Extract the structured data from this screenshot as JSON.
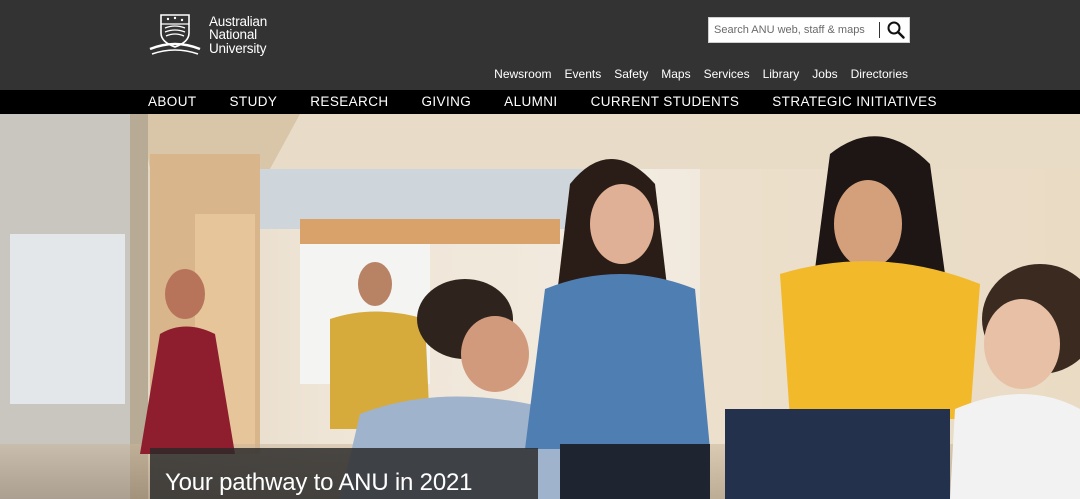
{
  "logo": {
    "lines": [
      "Australian",
      "National",
      "University"
    ]
  },
  "search": {
    "placeholder": "Search ANU web, staff & maps"
  },
  "utility_nav": [
    "Newsroom",
    "Events",
    "Safety",
    "Maps",
    "Services",
    "Library",
    "Jobs",
    "Directories"
  ],
  "main_nav": [
    "ABOUT",
    "STUDY",
    "RESEARCH",
    "GIVING",
    "ALUMNI",
    "CURRENT STUDENTS",
    "STRATEGIC INITIATIVES"
  ],
  "hero": {
    "caption": "Your pathway to ANU in 2021"
  },
  "colors": {
    "header_bg": "#333333",
    "nav_bg": "#000000",
    "text": "#ffffff"
  }
}
